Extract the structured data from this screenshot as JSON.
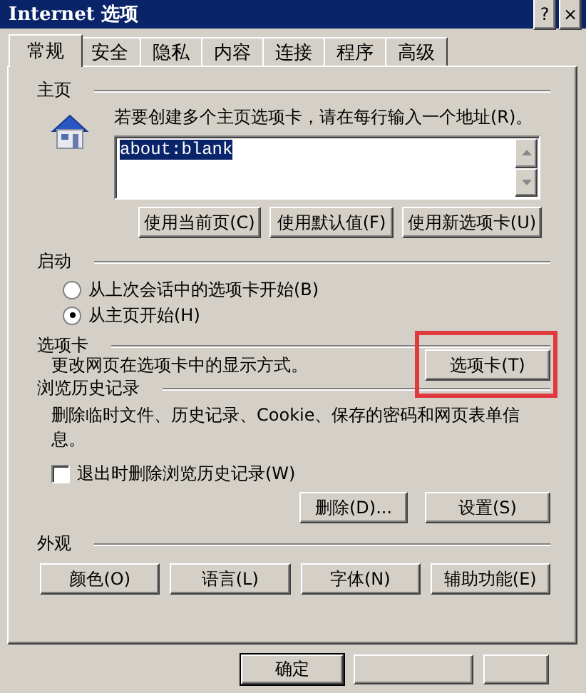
{
  "window": {
    "title": "Internet 选项",
    "title_buttons": [
      "?",
      "×"
    ]
  },
  "tabs": [
    {
      "label": "常规",
      "selected": true
    },
    {
      "label": "安全",
      "selected": false
    },
    {
      "label": "隐私",
      "selected": false
    },
    {
      "label": "内容",
      "selected": false
    },
    {
      "label": "连接",
      "selected": false
    },
    {
      "label": "程序",
      "selected": false
    },
    {
      "label": "高级",
      "selected": false
    }
  ],
  "home_page": {
    "heading": "主页",
    "instruction": "若要创建多个主页选项卡，请在每行输入一个地址(R)。",
    "value": "about:blank",
    "buttons": [
      "使用当前页(C)",
      "使用默认值(F)",
      "使用新选项卡(U)"
    ]
  },
  "startup": {
    "heading": "启动",
    "options": [
      {
        "label": "从上次会话中的选项卡开始(B)",
        "selected": false
      },
      {
        "label": "从主页开始(H)",
        "selected": true
      }
    ]
  },
  "tabs_section": {
    "heading": "选项卡",
    "description": "更改网页在选项卡中的显示方式。",
    "button": {
      "label": "选项卡(T)",
      "highlighted": true
    }
  },
  "history": {
    "heading": "浏览历史记录",
    "description": "删除临时文件、历史记录、Cookie、保存的密码和网页表单信息。",
    "checkbox": {
      "label": "退出时删除浏览历史记录(W)",
      "checked": false
    },
    "buttons": [
      "删除(D)...",
      "设置(S)"
    ]
  },
  "appearance": {
    "heading": "外观",
    "buttons": [
      "颜色(O)",
      "语言(L)",
      "字体(N)",
      "辅助功能(E)"
    ]
  },
  "footer_buttons": [
    {
      "kind": "default",
      "label": "确定"
    },
    {
      "kind": "blank"
    },
    {
      "kind": "blank"
    }
  ]
}
